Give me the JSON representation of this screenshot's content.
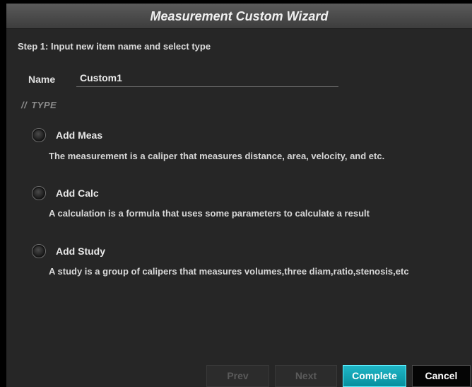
{
  "window": {
    "title": "Measurement Custom Wizard"
  },
  "step": {
    "text": "Step 1: Input new item name and select type"
  },
  "name_field": {
    "label": "Name",
    "value": "Custom1"
  },
  "type_section": {
    "marker": "//",
    "heading": "TYPE"
  },
  "options": [
    {
      "label": "Add Meas",
      "description": "The measurement is a caliper that measures distance, area, velocity, and etc.",
      "selected": false
    },
    {
      "label": "Add Calc",
      "description": "A calculation is a formula that uses some parameters to calculate a result",
      "selected": false
    },
    {
      "label": "Add Study",
      "description": "A study is a group of calipers that measures volumes,three diam,ratio,stenosis,etc",
      "selected": false
    }
  ],
  "buttons": {
    "prev": "Prev",
    "next": "Next",
    "complete": "Complete",
    "cancel": "Cancel"
  },
  "colors": {
    "background": "#262626",
    "titlebar": "#4a4a4a",
    "accent": "#0ea5b5",
    "accent_border": "#5ef0ff"
  }
}
